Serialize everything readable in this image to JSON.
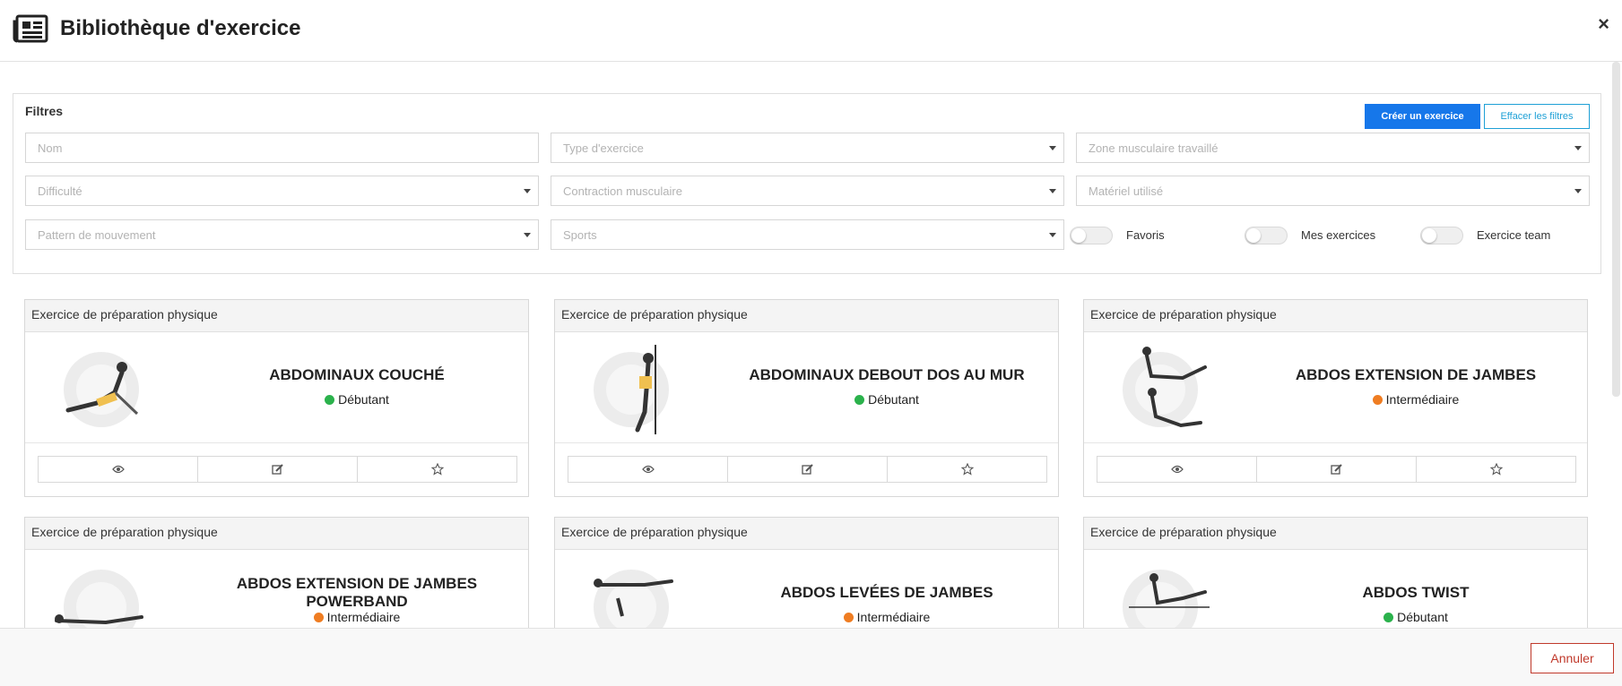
{
  "header": {
    "title": "Bibliothèque d'exercice",
    "close": "×"
  },
  "filters": {
    "title": "Filtres",
    "create_label": "Créer un exercice",
    "clear_label": "Effacer les filtres",
    "fields": {
      "nom": "Nom",
      "type": "Type d'exercice",
      "zone": "Zone musculaire travaillé",
      "difficulte": "Difficulté",
      "contraction": "Contraction musculaire",
      "materiel": "Matériel utilisé",
      "pattern": "Pattern de mouvement",
      "sports": "Sports"
    },
    "toggles": {
      "favoris": "Favoris",
      "mes": "Mes exercices",
      "team": "Exercice team"
    }
  },
  "cards": [
    {
      "category": "Exercice de préparation physique",
      "name": "ABDOMINAUX COUCHÉ",
      "level": "Débutant",
      "level_color": "#2bb24c"
    },
    {
      "category": "Exercice de préparation physique",
      "name": "ABDOMINAUX DEBOUT DOS AU MUR",
      "level": "Débutant",
      "level_color": "#2bb24c"
    },
    {
      "category": "Exercice de préparation physique",
      "name": "ABDOS EXTENSION DE JAMBES",
      "level": "Intermédiaire",
      "level_color": "#ef7d22"
    },
    {
      "category": "Exercice de préparation physique",
      "name": "ABDOS EXTENSION DE JAMBES POWERBAND",
      "level": "Intermédiaire",
      "level_color": "#ef7d22"
    },
    {
      "category": "Exercice de préparation physique",
      "name": "ABDOS LEVÉES DE JAMBES",
      "level": "Intermédiaire",
      "level_color": "#ef7d22"
    },
    {
      "category": "Exercice de préparation physique",
      "name": "ABDOS TWIST",
      "level": "Débutant",
      "level_color": "#2bb24c"
    }
  ],
  "footer": {
    "cancel_label": "Annuler"
  },
  "colors": {
    "primary": "#1677ea",
    "secondary": "#1ea0d6",
    "danger": "#c0392b"
  }
}
